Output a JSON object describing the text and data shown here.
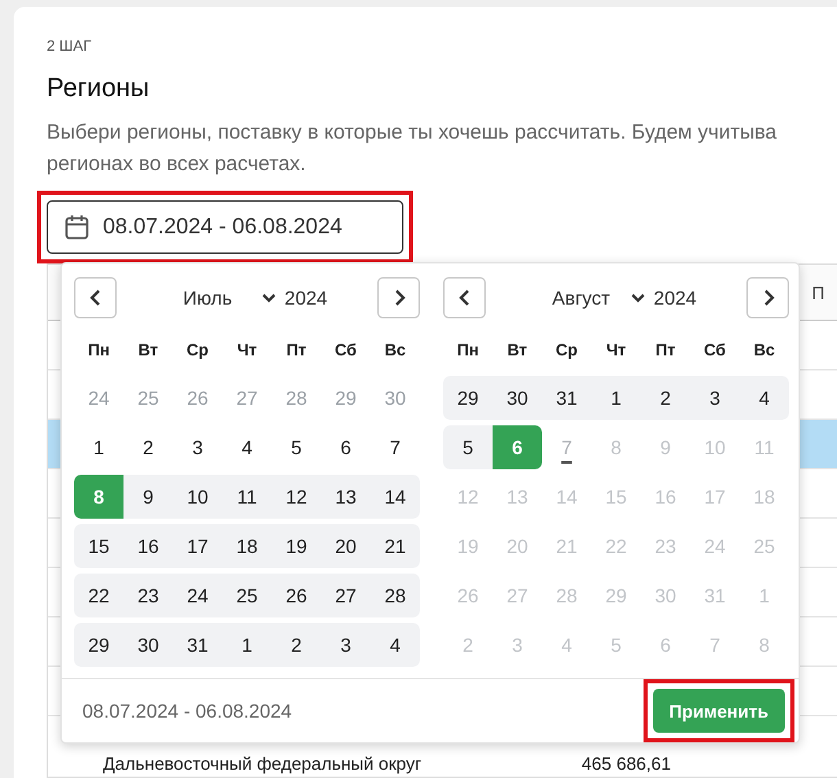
{
  "step": "2 ШАГ",
  "title": "Регионы",
  "description": [
    "Выбери регионы, поставку в которые ты хочешь рассчитать. Будем учитыва",
    "регионах во всех расчетах."
  ],
  "date_field": {
    "value": "08.07.2024 - 06.08.2024",
    "highlighted": true
  },
  "table": {
    "columns": [
      {
        "label": "П"
      }
    ],
    "rows": [
      {
        "selected": false
      },
      {
        "selected": false
      },
      {
        "selected": true
      },
      {
        "selected": false
      },
      {
        "selected": false
      },
      {
        "selected": false
      },
      {
        "selected": false
      },
      {
        "selected": false
      },
      {
        "name": "Дальневосточный федеральный округ",
        "value": "465 686,61",
        "selected": false
      }
    ]
  },
  "datepicker": {
    "months": [
      {
        "month": "Июль",
        "year": "2024",
        "weekdays": [
          "Пн",
          "Вт",
          "Ср",
          "Чт",
          "Пт",
          "Сб",
          "Вс"
        ],
        "weeks": [
          [
            {
              "day": "24",
              "kind": "outside"
            },
            {
              "day": "25",
              "kind": "outside"
            },
            {
              "day": "26",
              "kind": "outside"
            },
            {
              "day": "27",
              "kind": "outside"
            },
            {
              "day": "28",
              "kind": "outside"
            },
            {
              "day": "29",
              "kind": "outside"
            },
            {
              "day": "30",
              "kind": "outside"
            }
          ],
          [
            {
              "day": "1",
              "kind": "normal"
            },
            {
              "day": "2",
              "kind": "normal"
            },
            {
              "day": "3",
              "kind": "normal"
            },
            {
              "day": "4",
              "kind": "normal"
            },
            {
              "day": "5",
              "kind": "normal"
            },
            {
              "day": "6",
              "kind": "normal"
            },
            {
              "day": "7",
              "kind": "normal"
            }
          ],
          [
            {
              "day": "8",
              "kind": "start"
            },
            {
              "day": "9",
              "kind": "range"
            },
            {
              "day": "10",
              "kind": "range"
            },
            {
              "day": "11",
              "kind": "range"
            },
            {
              "day": "12",
              "kind": "range"
            },
            {
              "day": "13",
              "kind": "range"
            },
            {
              "day": "14",
              "kind": "range"
            }
          ],
          [
            {
              "day": "15",
              "kind": "range"
            },
            {
              "day": "16",
              "kind": "range"
            },
            {
              "day": "17",
              "kind": "range"
            },
            {
              "day": "18",
              "kind": "range"
            },
            {
              "day": "19",
              "kind": "range"
            },
            {
              "day": "20",
              "kind": "range"
            },
            {
              "day": "21",
              "kind": "range"
            }
          ],
          [
            {
              "day": "22",
              "kind": "range"
            },
            {
              "day": "23",
              "kind": "range"
            },
            {
              "day": "24",
              "kind": "range"
            },
            {
              "day": "25",
              "kind": "range"
            },
            {
              "day": "26",
              "kind": "range"
            },
            {
              "day": "27",
              "kind": "range"
            },
            {
              "day": "28",
              "kind": "range"
            }
          ],
          [
            {
              "day": "29",
              "kind": "range"
            },
            {
              "day": "30",
              "kind": "range"
            },
            {
              "day": "31",
              "kind": "range"
            },
            {
              "day": "1",
              "kind": "range"
            },
            {
              "day": "2",
              "kind": "range"
            },
            {
              "day": "3",
              "kind": "range"
            },
            {
              "day": "4",
              "kind": "range"
            }
          ]
        ]
      },
      {
        "month": "Август",
        "year": "2024",
        "weekdays": [
          "Пн",
          "Вт",
          "Ср",
          "Чт",
          "Пт",
          "Сб",
          "Вс"
        ],
        "weeks": [
          [
            {
              "day": "29",
              "kind": "range"
            },
            {
              "day": "30",
              "kind": "range"
            },
            {
              "day": "31",
              "kind": "range"
            },
            {
              "day": "1",
              "kind": "range"
            },
            {
              "day": "2",
              "kind": "range"
            },
            {
              "day": "3",
              "kind": "range"
            },
            {
              "day": "4",
              "kind": "range"
            }
          ],
          [
            {
              "day": "5",
              "kind": "range"
            },
            {
              "day": "6",
              "kind": "end"
            },
            {
              "day": "7",
              "kind": "today"
            },
            {
              "day": "8",
              "kind": "disabled"
            },
            {
              "day": "9",
              "kind": "disabled"
            },
            {
              "day": "10",
              "kind": "disabled"
            },
            {
              "day": "11",
              "kind": "disabled"
            }
          ],
          [
            {
              "day": "12",
              "kind": "disabled"
            },
            {
              "day": "13",
              "kind": "disabled"
            },
            {
              "day": "14",
              "kind": "disabled"
            },
            {
              "day": "15",
              "kind": "disabled"
            },
            {
              "day": "16",
              "kind": "disabled"
            },
            {
              "day": "17",
              "kind": "disabled"
            },
            {
              "day": "18",
              "kind": "disabled"
            }
          ],
          [
            {
              "day": "19",
              "kind": "disabled"
            },
            {
              "day": "20",
              "kind": "disabled"
            },
            {
              "day": "21",
              "kind": "disabled"
            },
            {
              "day": "22",
              "kind": "disabled"
            },
            {
              "day": "23",
              "kind": "disabled"
            },
            {
              "day": "24",
              "kind": "disabled"
            },
            {
              "day": "25",
              "kind": "disabled"
            }
          ],
          [
            {
              "day": "26",
              "kind": "disabled"
            },
            {
              "day": "27",
              "kind": "disabled"
            },
            {
              "day": "28",
              "kind": "disabled"
            },
            {
              "day": "29",
              "kind": "disabled"
            },
            {
              "day": "30",
              "kind": "disabled"
            },
            {
              "day": "31",
              "kind": "disabled"
            },
            {
              "day": "1",
              "kind": "disabled"
            }
          ],
          [
            {
              "day": "2",
              "kind": "disabled"
            },
            {
              "day": "3",
              "kind": "disabled"
            },
            {
              "day": "4",
              "kind": "disabled"
            },
            {
              "day": "5",
              "kind": "disabled"
            },
            {
              "day": "6",
              "kind": "disabled"
            },
            {
              "day": "7",
              "kind": "disabled"
            },
            {
              "day": "8",
              "kind": "disabled"
            }
          ]
        ]
      }
    ],
    "summary": "08.07.2024 - 06.08.2024",
    "apply_button": {
      "label": "Применить",
      "highlighted": true
    }
  }
}
